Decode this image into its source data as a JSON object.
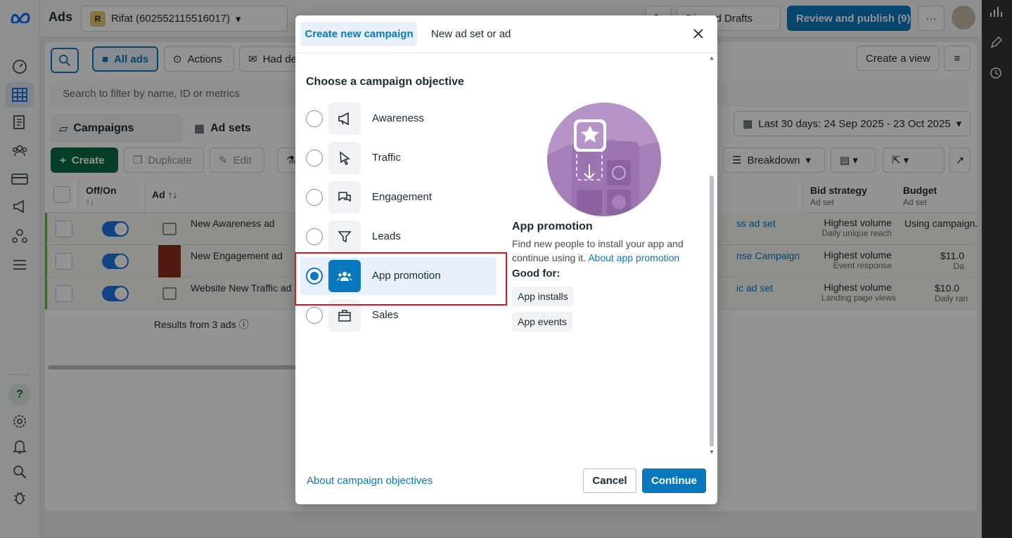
{
  "app": {
    "title": "Ads",
    "account_badge": "R",
    "account_name": "Rifat (602552115516017)",
    "discard_label": "Discard Drafts",
    "review_publish_label": "Review and publish (9)",
    "more_label": "···"
  },
  "toolbar": {
    "all_ads_label": "All ads",
    "actions_label": "Actions",
    "had_label": "Had de",
    "create_view_label": "Create a view",
    "search_placeholder": "Search to filter by name, ID or metrics"
  },
  "levels": {
    "campaigns_label": "Campaigns",
    "adsets_label": "Ad sets",
    "date_range_label": "Last 30 days: 24 Sep 2025 - 23 Oct 2025"
  },
  "actions_bar": {
    "create_label": "Create",
    "duplicate_label": "Duplicate",
    "edit_label": "Edit",
    "breakdown_label": "Breakdown"
  },
  "table": {
    "headers": {
      "off_on": "Off/On",
      "ad": "Ad",
      "bid_strategy": "Bid strategy",
      "bid_strategy_sub": "Ad set",
      "budget": "Budget",
      "budget_sub": "Ad set",
      "sort_symbol": "↑↓"
    },
    "rows": [
      {
        "name": "New Awareness ad",
        "adset": "ss ad set",
        "bid": "Highest volume",
        "bid_sub": "Daily unique reach",
        "budget": "Using campaign.",
        "budget_sub": ""
      },
      {
        "name": "New Engagement ad",
        "adset": "nse Campaign",
        "bid": "Highest volume",
        "bid_sub": "Event response",
        "budget": "$11.0",
        "budget_sub": "Da"
      },
      {
        "name": "Website New Traffic ad",
        "adset": "ic ad set",
        "bid": "Highest volume",
        "bid_sub": "Landing page views",
        "budget": "$10.0",
        "budget_sub": "Daily ran"
      }
    ],
    "results_label": "Results from 3 ads"
  },
  "dialog": {
    "tabs": [
      "Create new campaign",
      "New ad set or ad"
    ],
    "title": "Choose a campaign objective",
    "objectives": [
      {
        "label": "Awareness",
        "icon": "megaphone-icon",
        "selected": false
      },
      {
        "label": "Traffic",
        "icon": "cursor-icon",
        "selected": false
      },
      {
        "label": "Engagement",
        "icon": "chat-bubbles-icon",
        "selected": false
      },
      {
        "label": "Leads",
        "icon": "filter-funnel-icon",
        "selected": false
      },
      {
        "label": "App promotion",
        "icon": "people-group-icon",
        "selected": true
      },
      {
        "label": "Sales",
        "icon": "shopping-bag-icon",
        "selected": false
      }
    ],
    "detail": {
      "name": "App promotion",
      "description": "Find new people to install your app and continue using it.",
      "about_link": "About app promotion",
      "good_for_label": "Good for:",
      "good_for": [
        "App installs",
        "App events"
      ]
    },
    "footer": {
      "about_link": "About campaign objectives",
      "cancel_label": "Cancel",
      "continue_label": "Continue"
    }
  },
  "colors": {
    "accent": "#0a78be",
    "highlight": "#e0141e",
    "create_green": "#0b6a43",
    "illustration": "#b794c8"
  }
}
